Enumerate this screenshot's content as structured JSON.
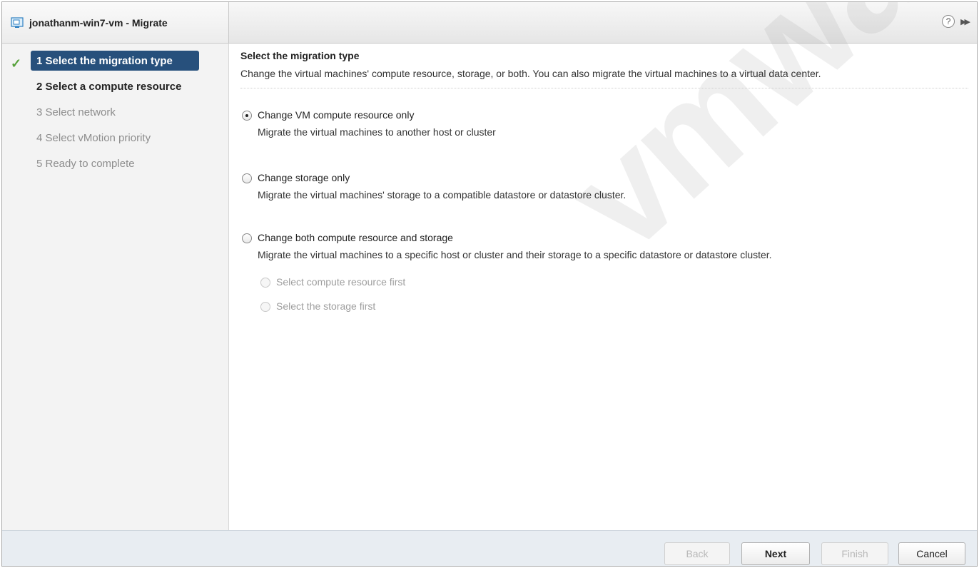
{
  "window": {
    "title": "jonathanm-win7-vm - Migrate",
    "help_icon": "?",
    "expand_icon": "▶▶"
  },
  "steps": [
    {
      "label": "1  Select the migration type",
      "state": "active"
    },
    {
      "label": "2  Select a compute resource",
      "state": "enabled"
    },
    {
      "label": "3  Select network",
      "state": "disabled"
    },
    {
      "label": "4  Select vMotion priority",
      "state": "disabled"
    },
    {
      "label": "5  Ready to complete",
      "state": "disabled"
    }
  ],
  "content": {
    "title": "Select the migration type",
    "description": "Change the virtual machines' compute resource, storage, or both. You can also migrate the virtual machines to a virtual data center.",
    "options": [
      {
        "label": "Change VM compute resource only",
        "description": "Migrate the virtual machines to another host or cluster",
        "checked": true
      },
      {
        "label": "Change storage only",
        "description": "Migrate the virtual machines' storage to a compatible datastore or datastore cluster.",
        "checked": false
      },
      {
        "label": "Change both compute resource and storage",
        "description": "Migrate the virtual machines to a specific host or cluster and their storage to a specific datastore or datastore cluster.",
        "checked": false
      }
    ],
    "sub_options": [
      {
        "label": "Select compute resource first"
      },
      {
        "label": "Select the storage first"
      }
    ],
    "watermark": "vmware"
  },
  "footer": {
    "back": "Back",
    "next": "Next",
    "finish": "Finish",
    "cancel": "Cancel"
  },
  "colors": {
    "active_step_bg": "#27507c",
    "check": "#56a13a",
    "footer_bg": "#e8edf2"
  }
}
